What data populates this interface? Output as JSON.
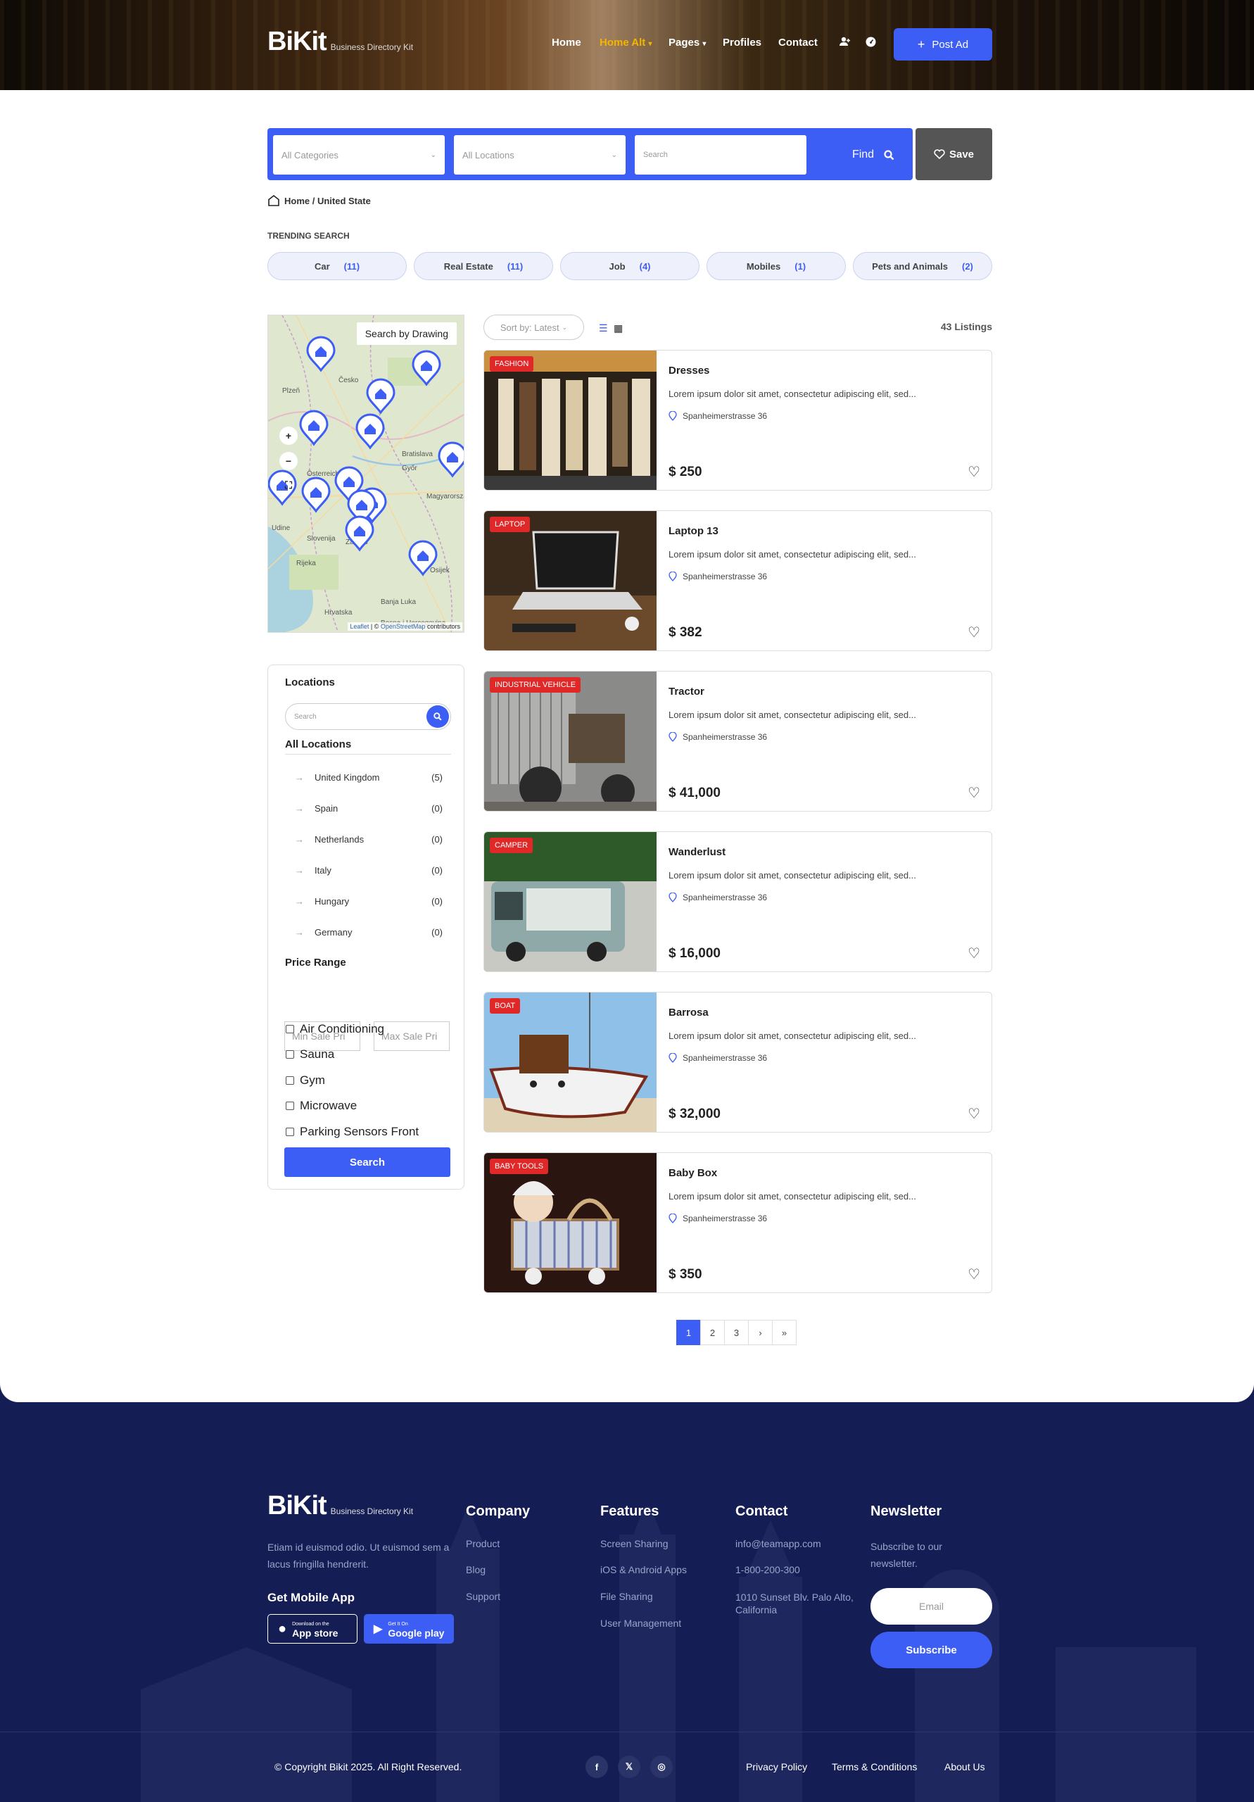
{
  "header": {
    "logo": "BiKit",
    "tagline": "Business Directory Kit",
    "nav": [
      {
        "label": "Home",
        "active": false
      },
      {
        "label": "Home Alt",
        "active": true
      },
      {
        "label": "Pages",
        "active": false
      },
      {
        "label": "Profiles",
        "active": false
      },
      {
        "label": "Contact",
        "active": false
      }
    ],
    "post_ad": "Post Ad"
  },
  "search": {
    "category": "All Categories",
    "location": "All Locations",
    "keyword_placeholder": "Search",
    "find": "Find",
    "save": "Save"
  },
  "breadcrumb": "Home / United State",
  "trending": {
    "title": "TRENDING SEARCH",
    "items": [
      {
        "label": "Car",
        "count": "(11)"
      },
      {
        "label": "Real Estate",
        "count": "(11)"
      },
      {
        "label": "Job",
        "count": "(4)"
      },
      {
        "label": "Mobiles",
        "count": "(1)"
      },
      {
        "label": "Pets and Animals",
        "count": "(2)"
      }
    ]
  },
  "map": {
    "draw_button": "Search by Drawing",
    "zoom_in": "+",
    "zoom_out": "−",
    "attribution_leaflet": "Leaflet",
    "attribution_osm": "OpenStreetMap",
    "attribution_suffix": "contributors",
    "labels": [
      "Česko",
      "Bratislava",
      "Österreich",
      "Magyarország",
      "Slovenija",
      "Hrvatska",
      "Zagreb",
      "Győr",
      "Banja Luka",
      "Osijek",
      "Plzeň",
      "Udine",
      "Rijeka",
      "Bosna i Hercegovina"
    ]
  },
  "sidebar": {
    "locations_title": "Locations",
    "search_placeholder": "Search",
    "all_locations": "All Locations",
    "locations": [
      {
        "name": "United Kingdom",
        "count": "(5)"
      },
      {
        "name": "Spain",
        "count": "(0)"
      },
      {
        "name": "Netherlands",
        "count": "(0)"
      },
      {
        "name": "Italy",
        "count": "(0)"
      },
      {
        "name": "Hungary",
        "count": "(0)"
      },
      {
        "name": "Germany",
        "count": "(0)"
      }
    ],
    "price_title": "Price Range",
    "min_placeholder": "Min Sale Pri",
    "max_placeholder": "Max Sale Pri",
    "amenities": [
      "Air Conditioning",
      "Sauna",
      "Gym",
      "Microwave",
      "Parking Sensors Front"
    ],
    "search_button": "Search"
  },
  "listing_bar": {
    "sort": "Sort by: Latest",
    "count": "43 Listings"
  },
  "listings": [
    {
      "badge": "FASHION",
      "title": "Dresses",
      "desc": "Lorem ipsum dolor sit amet, consectetur adipiscing elit, sed...",
      "address": "Spanheimerstrasse 36",
      "price": "$ 250"
    },
    {
      "badge": "LAPTOP",
      "title": "Laptop 13",
      "desc": "Lorem ipsum dolor sit amet, consectetur adipiscing elit, sed...",
      "address": "Spanheimerstrasse 36",
      "price": "$ 382"
    },
    {
      "badge": "INDUSTRIAL VEHICLE",
      "title": "Tractor",
      "desc": "Lorem ipsum dolor sit amet, consectetur adipiscing elit, sed...",
      "address": "Spanheimerstrasse 36",
      "price": "$ 41,000"
    },
    {
      "badge": "CAMPER",
      "title": "Wanderlust",
      "desc": "Lorem ipsum dolor sit amet, consectetur adipiscing elit, sed...",
      "address": "Spanheimerstrasse 36",
      "price": "$ 16,000"
    },
    {
      "badge": "BOAT",
      "title": "Barrosa",
      "desc": "Lorem ipsum dolor sit amet, consectetur adipiscing elit, sed...",
      "address": "Spanheimerstrasse 36",
      "price": "$ 32,000"
    },
    {
      "badge": "BABY TOOLS",
      "title": "Baby Box",
      "desc": "Lorem ipsum dolor sit amet, consectetur adipiscing elit, sed...",
      "address": "Spanheimerstrasse 36",
      "price": "$ 350"
    }
  ],
  "pagination": [
    "1",
    "2",
    "3",
    "›",
    "»"
  ],
  "footer": {
    "logo": "BiKit",
    "tagline": "Business Directory Kit",
    "about": "Etiam id euismod odio. Ut euismod sem a lacus fringilla hendrerit.",
    "app_title": "Get Mobile App",
    "appstore_small": "Download on the",
    "appstore": "App store",
    "googleplay_small": "Get It On",
    "googleplay": "Google play",
    "company_title": "Company",
    "company": [
      "Product",
      "Blog",
      "Support"
    ],
    "features_title": "Features",
    "features": [
      "Screen Sharing",
      "iOS & Android Apps",
      "File Sharing",
      "User Management"
    ],
    "contact_title": "Contact",
    "contact": [
      "info@teamapp.com",
      "1-800-200-300",
      "1010 Sunset Blv. Palo Alto, California"
    ],
    "newsletter_title": "Newsletter",
    "newsletter_text": "Subscribe to our newsletter.",
    "email_placeholder": "Email",
    "subscribe": "Subscribe",
    "copyright": "© Copyright Bikit 2025. All Right Reserved.",
    "legal": [
      "Privacy Policy",
      "Terms & Conditions",
      "About Us"
    ]
  },
  "colors": {
    "accent": "#3d5ef5",
    "active_nav": "#f5b400",
    "badge": "#e02828",
    "footer": "#151e54"
  }
}
